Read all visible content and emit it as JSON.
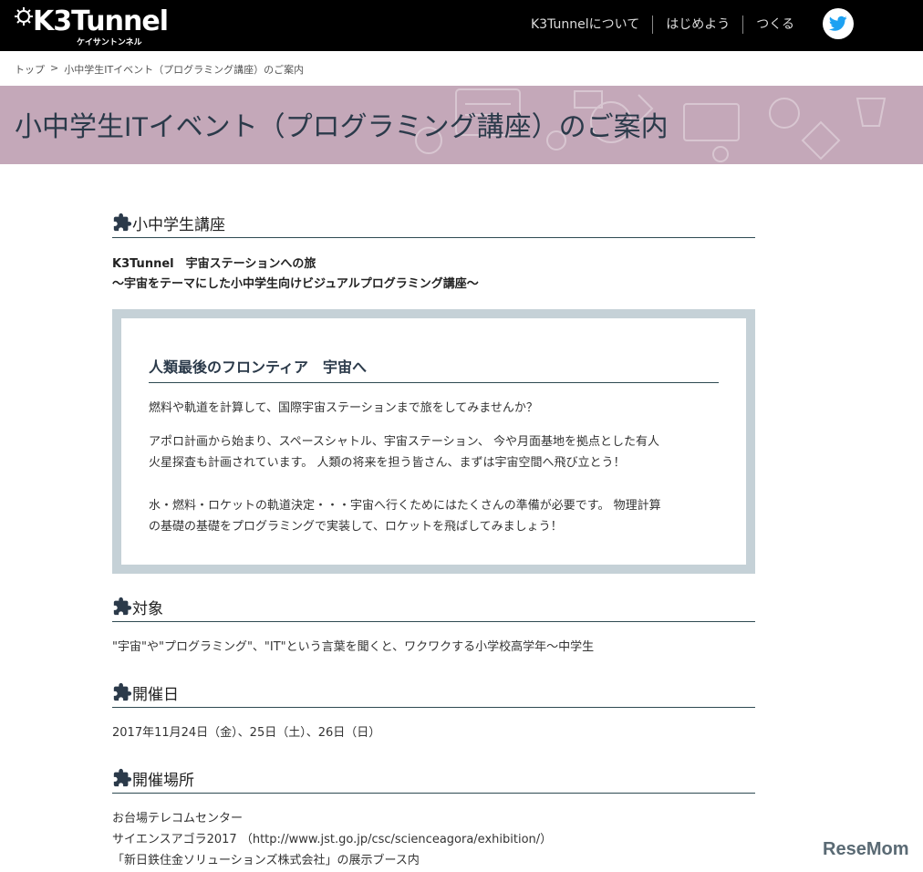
{
  "header": {
    "logo_text": "K3Tunnel",
    "logo_sub": "ケイサントンネル",
    "nav": [
      "K3Tunnelについて",
      "はじめよう",
      "つくる"
    ],
    "icons": [
      "gear-icon",
      "twitter-icon"
    ]
  },
  "breadcrumb": {
    "home": "トップ",
    "separator": ">",
    "current": "小中学生ITイベント（プログラミング講座）のご案内"
  },
  "banner": {
    "title": "小中学生ITイベント（プログラミング講座）のご案内",
    "background": "#c4a8b9"
  },
  "sections": {
    "course": {
      "heading": "小中学生講座",
      "title_line1": "K3Tunnel　宇宙ステーションへの旅",
      "title_line2": "～宇宙をテーマにした小中学生向けビジュアルプログラミング講座～"
    },
    "box": {
      "heading": "人類最後のフロンティア　宇宙へ",
      "p1": "燃料や軌道を計算して、国際宇宙ステーションまで旅をしてみませんか？",
      "p2_line1": "アポロ計画から始まり、スペースシャトル、宇宙ステーション、 今や月面基地を拠点とした有人",
      "p2_line2": "火星探査も計画されています。 人類の将来を担う皆さん、まずは宇宙空間へ飛び立とう！",
      "p3_line1": "水・燃料・ロケットの軌道決定・・・宇宙へ行くためにはたくさんの準備が必要です。 物理計算",
      "p3_line2": "の基礎の基礎をプログラミングで実装して、ロケットを飛ばしてみましょう！"
    },
    "target": {
      "heading": "対象",
      "text": "\"宇宙\"や\"プログラミング\"、\"IT\"という言葉を聞くと、ワクワクする小学校高学年～中学生"
    },
    "date": {
      "heading": "開催日",
      "text": "2017年11月24日（金）、25日（土）、26日（日）"
    },
    "venue": {
      "heading": "開催場所",
      "line1": "お台場テレコムセンター",
      "line2_prefix": "サイエンスアゴラ2017 （",
      "line2_link": "http://www.jst.go.jp/csc/scienceagora/exhibition/",
      "line2_suffix": "）",
      "line3": "「新日鉄住金ソリューションズ株式会社」の展示ブース内"
    }
  },
  "watermark": "ReseMom",
  "colors": {
    "header_bg": "#000000",
    "rule": "#2e4a52",
    "box_border": "#c5d1d7",
    "twitter": "#1da1f2"
  }
}
